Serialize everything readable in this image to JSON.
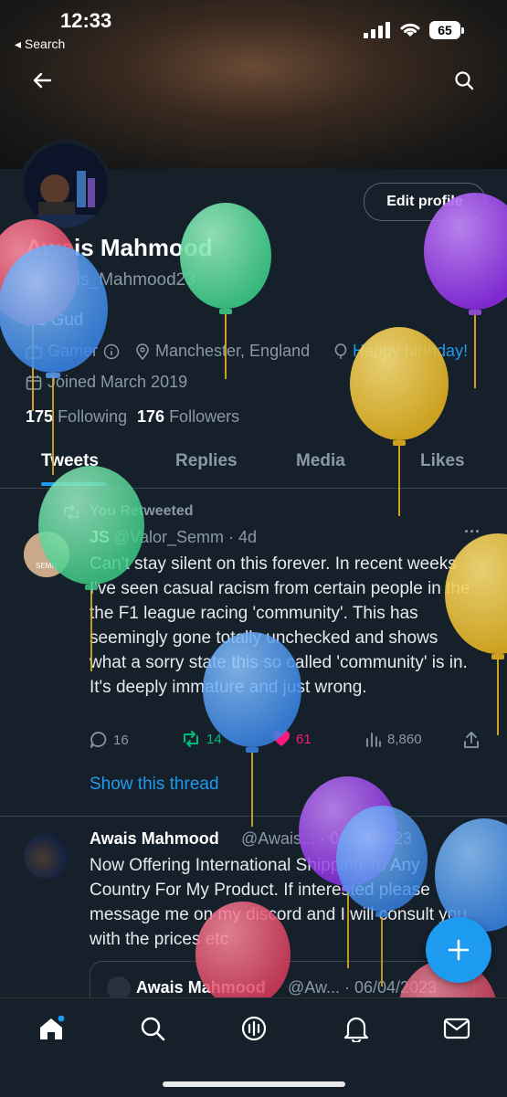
{
  "status": {
    "time": "12:33",
    "back_app": "◂ Search",
    "battery": "65"
  },
  "profile": {
    "name": "Awais Mahmood",
    "handle": "@Awais_Mahmood23",
    "bio": "F1 Gud",
    "category": "Gamer",
    "location": "Manchester, England",
    "birthday": "Happy birthday!",
    "joined": "Joined March 2019",
    "following_count": "175",
    "following_label": "Following",
    "followers_count": "176",
    "followers_label": "Followers",
    "edit_label": "Edit profile"
  },
  "tabs": [
    "Tweets",
    "Replies",
    "Media",
    "Likes"
  ],
  "tweet1": {
    "retweet_label": "You Retweeted",
    "author_initials": "JS",
    "handle_time": "@Valor_Semm · 4d",
    "avatar_text": "SEMM",
    "text": "Can't stay silent on this forever. In recent weeks I've seen casual racism from certain people in the the F1 league racing 'community'. This has seemingly gone totally unchecked and shows what a sorry state this so called 'community' is in. It's deeply immature and just wrong.",
    "replies": "16",
    "retweets": "14",
    "likes": "61",
    "views": "8,860",
    "show_thread": "Show this thread"
  },
  "tweet2": {
    "author": "Awais Mahmood",
    "handle_time": "@Awais... · 06/04/2023",
    "text": "Now Offering International Shipping To Any Country For My Product. If interested please message me on my discord and I will consult you with the prices etc",
    "quote_author": "Awais Mahmood",
    "quote_handle_time": "@Aw... · 06/04/2023"
  },
  "colors": {
    "bg": "#15202b",
    "accent": "#1d9bf0",
    "retweet": "#00ba7c",
    "like": "#f91880"
  },
  "icons": [
    "back-arrow-icon",
    "search-icon",
    "home-icon",
    "spaces-icon",
    "bell-icon",
    "mail-icon",
    "compose-plus-icon"
  ]
}
